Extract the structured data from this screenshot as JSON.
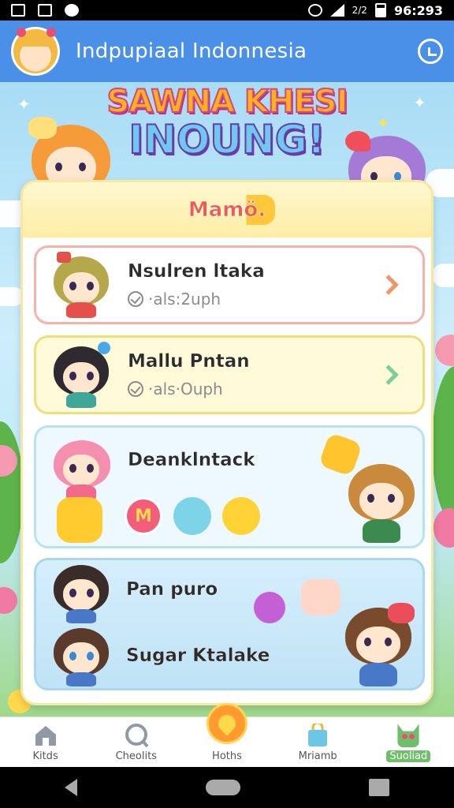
{
  "status_bar": {
    "time": "96:293",
    "carrier": "2/2"
  },
  "app_bar": {
    "title": "Indpupiaal Indonnesia"
  },
  "logo": {
    "line1": "SAWNA KHESI",
    "line2": "INOUNG!"
  },
  "panel": {
    "title": "Mamö."
  },
  "cards": [
    {
      "name": "Nsulren ltaka",
      "meta": "·als:2uph",
      "chevron_color": "#f2956b"
    },
    {
      "name": "Mallu Pntan",
      "meta": "·als·Ouph",
      "chevron_color": "#7bcf9a"
    },
    {
      "name": "Deanklntack"
    },
    {
      "name_a": "Pan puro",
      "name_b": "Sugar Ktalake"
    }
  ],
  "bottom_nav": [
    {
      "label": "Kitds",
      "icon": "home-icon"
    },
    {
      "label": "Cheolits",
      "icon": "chat-icon"
    },
    {
      "label": "Hoths",
      "icon": "heart-icon"
    },
    {
      "label": "Mriamb",
      "icon": "bag-icon"
    },
    {
      "label": "Suoliad",
      "icon": "cat-icon"
    }
  ],
  "colors": {
    "app_bar": "#4a90e8",
    "accent": "#ff9a2f"
  }
}
